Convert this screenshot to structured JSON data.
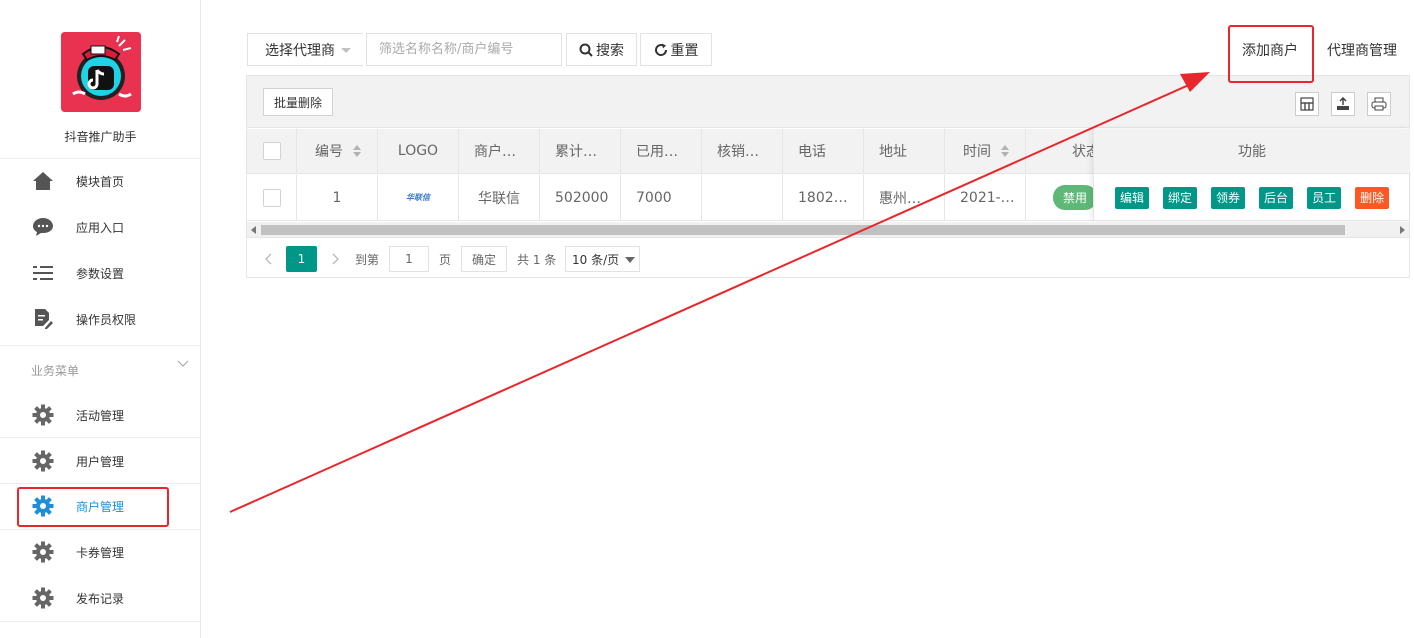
{
  "sidebar": {
    "app_name": "抖音推广助手",
    "logo_icon": "tiktok-mascot-icon",
    "items": [
      {
        "label": "模块首页",
        "icon": "home-icon"
      },
      {
        "label": "应用入口",
        "icon": "chat-icon"
      },
      {
        "label": "参数设置",
        "icon": "list-settings-icon"
      },
      {
        "label": "操作员权限",
        "icon": "document-edit-icon"
      }
    ],
    "group_title": "业务菜单",
    "group_items": [
      {
        "label": "活动管理",
        "icon": "gear-icon"
      },
      {
        "label": "用户管理",
        "icon": "gear-icon"
      },
      {
        "label": "商户管理",
        "icon": "gear-icon",
        "active": true
      },
      {
        "label": "卡券管理",
        "icon": "gear-icon"
      },
      {
        "label": "发布记录",
        "icon": "gear-icon"
      }
    ]
  },
  "toolbar": {
    "agent_select": "选择代理商",
    "search_placeholder": "筛选名称名称/商户编号",
    "search_label": "搜索",
    "reset_label": "重置",
    "add_merchant": "添加商户",
    "agent_manage": "代理商管理"
  },
  "table": {
    "batch_delete": "批量删除",
    "columns": [
      "编号",
      "LOGO",
      "商户…",
      "累计…",
      "已用…",
      "核销…",
      "电话",
      "地址",
      "时间",
      "状态",
      "功能"
    ],
    "row": {
      "id": "1",
      "logo_text": "华联信",
      "merchant": "华联信",
      "total": "502000",
      "used": "7000",
      "verified": "",
      "phone": "1802…",
      "address": "惠州…",
      "time": "2021-…",
      "status": "禁用"
    },
    "actions": [
      "编辑",
      "绑定",
      "领券",
      "后台",
      "员工",
      "删除"
    ]
  },
  "pager": {
    "current": "1",
    "goto_label": "到第",
    "goto_value": "1",
    "page_unit": "页",
    "confirm": "确定",
    "total": "共 1 条",
    "page_size": "10 条/页"
  },
  "colors": {
    "primary": "#009688",
    "danger": "#ff5722",
    "active_nav": "#1e8ed8",
    "annotation": "#e8262b",
    "status_badge": "#5fb878"
  }
}
